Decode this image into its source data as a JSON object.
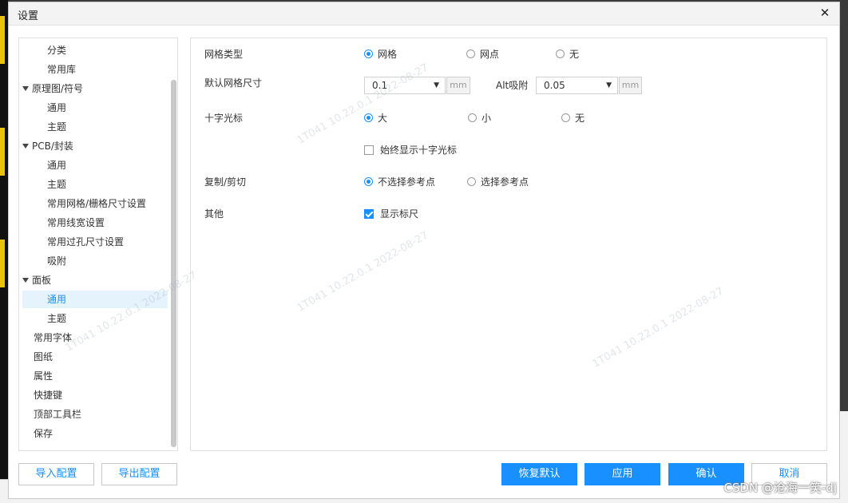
{
  "window": {
    "title": "设置",
    "close_glyph": "✕"
  },
  "sidebar": {
    "items": [
      {
        "label": "分类",
        "level": 1
      },
      {
        "label": "常用库",
        "level": 1
      },
      {
        "label": "原理图/符号",
        "level": 0,
        "expanded": true
      },
      {
        "label": "通用",
        "level": 1
      },
      {
        "label": "主题",
        "level": 1
      },
      {
        "label": "PCB/封装",
        "level": 0,
        "expanded": true
      },
      {
        "label": "通用",
        "level": 1
      },
      {
        "label": "主题",
        "level": 1
      },
      {
        "label": "常用网格/栅格尺寸设置",
        "level": 1
      },
      {
        "label": "常用线宽设置",
        "level": 1
      },
      {
        "label": "常用过孔尺寸设置",
        "level": 1
      },
      {
        "label": "吸附",
        "level": 1
      },
      {
        "label": "面板",
        "level": 0,
        "expanded": true
      },
      {
        "label": "通用",
        "level": 1,
        "selected": true
      },
      {
        "label": "主题",
        "level": 1
      },
      {
        "label": "常用字体",
        "level": 0
      },
      {
        "label": "图纸",
        "level": 0
      },
      {
        "label": "属性",
        "level": 0
      },
      {
        "label": "快捷键",
        "level": 0
      },
      {
        "label": "顶部工具栏",
        "level": 0
      },
      {
        "label": "保存",
        "level": 0
      }
    ]
  },
  "settings": {
    "grid_type": {
      "label": "网格类型",
      "options": [
        "网格",
        "网点",
        "无"
      ],
      "selected": 0
    },
    "grid_size": {
      "label": "默认网格尺寸",
      "value": "0.1",
      "unit": "mm",
      "alt_label": "Alt吸附",
      "alt_value": "0.05",
      "alt_unit": "mm"
    },
    "crosshair": {
      "label": "十字光标",
      "options": [
        "大",
        "小",
        "无"
      ],
      "selected": 0
    },
    "always_show_crosshair": {
      "label": "始终显示十字光标",
      "checked": false
    },
    "copy_cut": {
      "label": "复制/剪切",
      "options": [
        "不选择参考点",
        "选择参考点"
      ],
      "selected": 0
    },
    "other": {
      "label": "其他",
      "show_ruler_label": "显示标尺",
      "checked": true
    }
  },
  "footer": {
    "import_label": "导入配置",
    "export_label": "导出配置",
    "restore_label": "恢复默认",
    "apply_label": "应用",
    "ok_label": "确认",
    "cancel_label": "取消"
  },
  "watermark": {
    "text": "1T041 10.22.0.1 2022-08-27"
  },
  "csdn_mark": "CSDN @沧海一笑-dj",
  "colors": {
    "accent": "#1890ff",
    "selected_bg": "#e5f3fd"
  }
}
